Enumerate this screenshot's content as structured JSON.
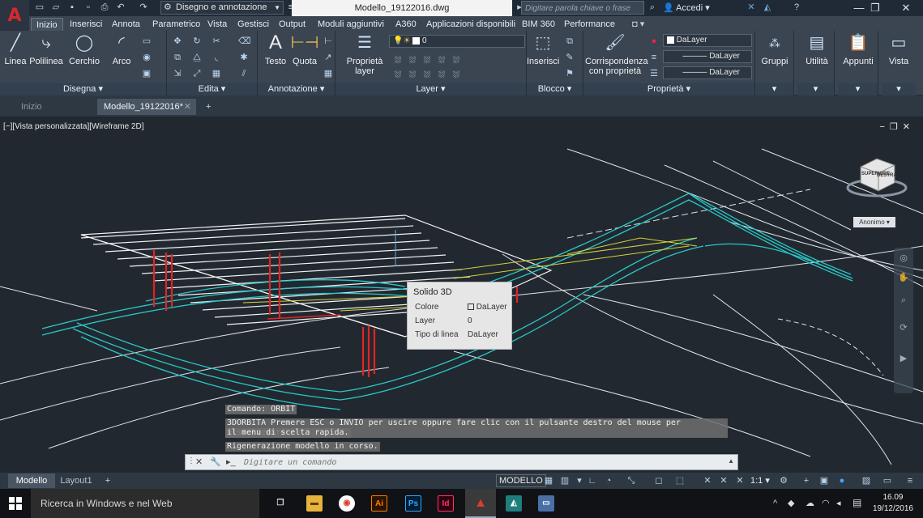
{
  "app": {
    "logo": "A",
    "title": "Modello_19122016.dwg"
  },
  "quick_access": {
    "workspace": "Disegno e annotazione"
  },
  "infocenter": {
    "search_placeholder": "Digitare parola chiave o frase",
    "signin": "Accedi"
  },
  "ribbon_tabs": [
    "Inizio",
    "Inserisci",
    "Annota",
    "Parametrico",
    "Vista",
    "Gestisci",
    "Output",
    "Moduli aggiuntivi",
    "A360",
    "Applicazioni disponibili",
    "BIM 360",
    "Performance"
  ],
  "ribbon": {
    "disegna": {
      "title": "Disegna",
      "tools": [
        "Linea",
        "Polilinea",
        "Cerchio",
        "Arco"
      ]
    },
    "edita": {
      "title": "Edita"
    },
    "annotazione": {
      "title": "Annotazione",
      "tools": [
        "Testo",
        "Quota"
      ]
    },
    "layer": {
      "title": "Layer",
      "props_label": "Proprietà layer",
      "current": "0"
    },
    "blocco": {
      "title": "Blocco",
      "insert": "Inserisci"
    },
    "match": {
      "label": "Corrispondenza con proprietà"
    },
    "proprieta": {
      "title": "Proprietà",
      "color": "DaLayer",
      "linetype": "DaLayer",
      "lineweight": "DaLayer"
    },
    "gruppi": {
      "title": "Gruppi"
    },
    "utilita": {
      "title": "Utilità"
    },
    "appunti": {
      "title": "Appunti"
    },
    "vista": {
      "title": "Vista"
    }
  },
  "doc_tabs": {
    "start": "Inizio",
    "file": "Modello_19122016*"
  },
  "viewport": {
    "label": "[−][Vista personalizzata][Wireframe 2D]",
    "viewcube_top": "SUPERIORE",
    "viewcube_front": "DESTRA",
    "ucs": "Anonimo"
  },
  "tooltip": {
    "title": "Solido 3D",
    "rows": [
      {
        "key": "Colore",
        "value": "DaLayer"
      },
      {
        "key": "Layer",
        "value": "0"
      },
      {
        "key": "Tipo di linea",
        "value": "DaLayer"
      }
    ]
  },
  "command": {
    "history": [
      "Comando: ORBIT",
      "3DORBITA Premere ESC o INVIO per uscire oppure fare clic con il pulsante destro del mouse per visualizzare",
      "il menu di scelta rapida.",
      "Rigenerazione modello in corso."
    ],
    "placeholder": "Digitare un comando"
  },
  "layout_tabs": [
    "Modello",
    "Layout1"
  ],
  "status": {
    "space": "MODELLO",
    "scale": "1:1"
  },
  "taskbar": {
    "search": "Ricerca in Windows e nel Web",
    "time": "16.09",
    "date": "19/12/2016"
  }
}
